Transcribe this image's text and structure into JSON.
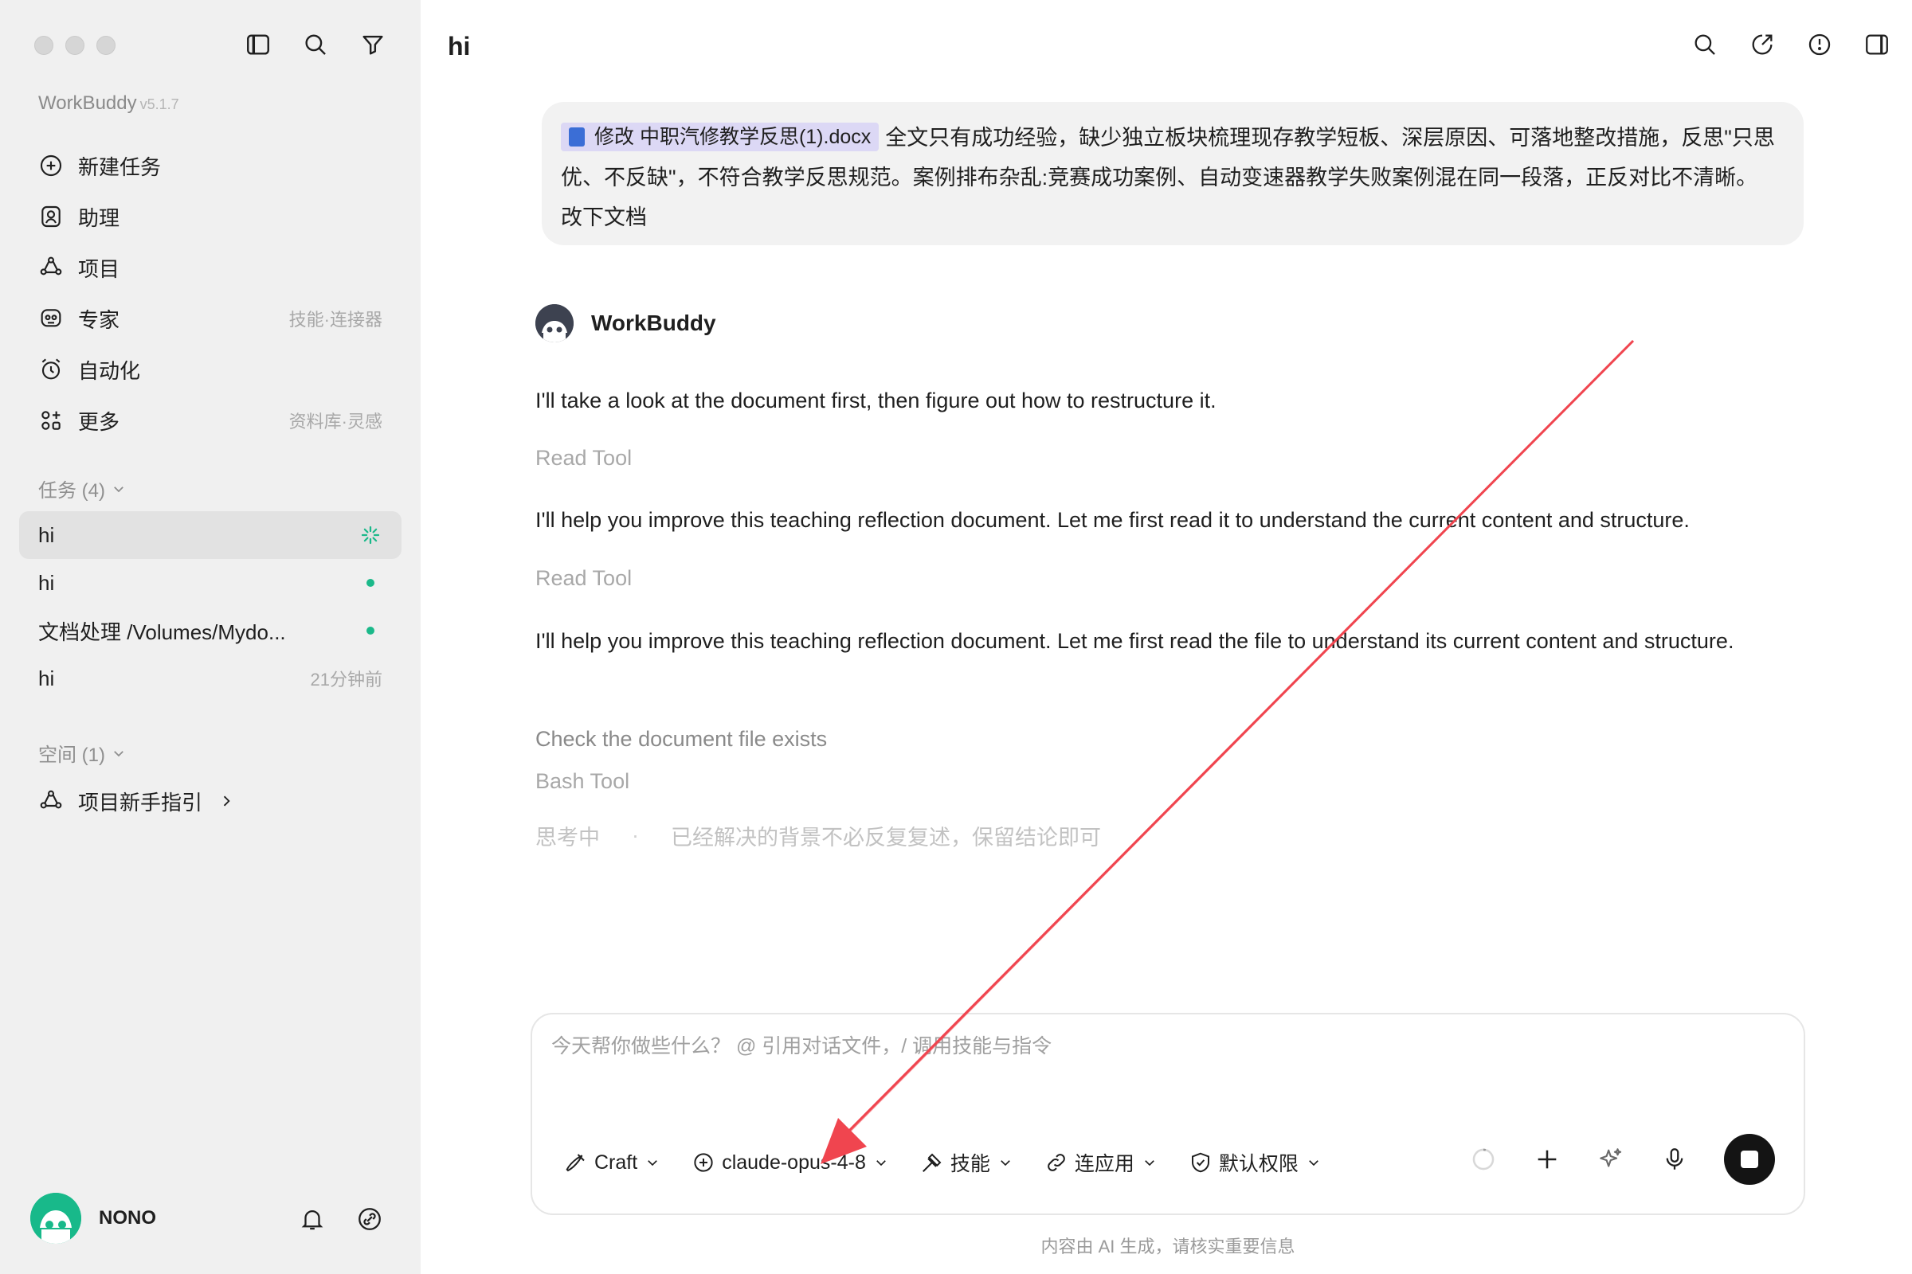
{
  "app": {
    "name": "WorkBuddy",
    "version": "v5.1.7"
  },
  "sidebar": {
    "nav": [
      {
        "label": "新建任务",
        "hint": "",
        "icon": "plus-circle-icon"
      },
      {
        "label": "助理",
        "hint": "",
        "icon": "assistant-icon"
      },
      {
        "label": "项目",
        "hint": "",
        "icon": "project-icon"
      },
      {
        "label": "专家",
        "hint": "技能·连接器",
        "icon": "expert-icon"
      },
      {
        "label": "自动化",
        "hint": "",
        "icon": "alarm-clock-icon"
      },
      {
        "label": "更多",
        "hint": "资料库·灵感",
        "icon": "grid-icon"
      }
    ],
    "tasks_header": "任务 (4)",
    "tasks": [
      {
        "label": "hi",
        "status": "running",
        "time": ""
      },
      {
        "label": "hi",
        "status": "unread",
        "time": ""
      },
      {
        "label": "文档处理 /Volumes/Mydo...",
        "status": "unread",
        "time": ""
      },
      {
        "label": "hi",
        "status": "",
        "time": "21分钟前"
      }
    ],
    "spaces_header": "空间 (1)",
    "spaces": [
      {
        "label": "项目新手指引"
      }
    ],
    "user": {
      "name": "NONO"
    }
  },
  "main": {
    "title": "hi",
    "user_message": {
      "file_name": "修改 中职汽修教学反思(1).docx",
      "text": "全文只有成功经验，缺少独立板块梳理现存教学短板、深层原因、可落地整改措施，反思\"只思优、不反缺\"，不符合教学反思规范。案例排布杂乱:竞赛成功案例、自动变速器教学失败案例混在同一段落，正反对比不清晰。 改下文档"
    },
    "assistant": {
      "name": "WorkBuddy",
      "msg1": "I'll take a look at the document first, then figure out how to restructure it.",
      "tool1": "Read Tool",
      "msg2": "I'll help you improve this teaching reflection document. Let me first read it to understand the current content and structure.",
      "tool2": "Read Tool",
      "msg3": "I'll help you improve this teaching reflection document. Let me first read the file to understand its current content and structure.",
      "step": "Check the document file exists",
      "tool3": "Bash Tool",
      "thinking_label": "思考中",
      "thinking_sep": "·",
      "thinking_text": "已经解决的背景不必反复复述，保留结论即可"
    },
    "composer": {
      "placeholder": "今天帮你做些什么？ @ 引用对话文件，/ 调用技能与指令",
      "mode": "Craft",
      "model": "claude-opus-4-8",
      "skills": "技能",
      "apps": "连应用",
      "permission": "默认权限"
    },
    "disclaimer": "内容由 AI 生成，请核实重要信息"
  },
  "colors": {
    "accent": "#1bb98a",
    "annotation_arrow": "#f0454f",
    "file_chip": "#dcd8f5"
  }
}
